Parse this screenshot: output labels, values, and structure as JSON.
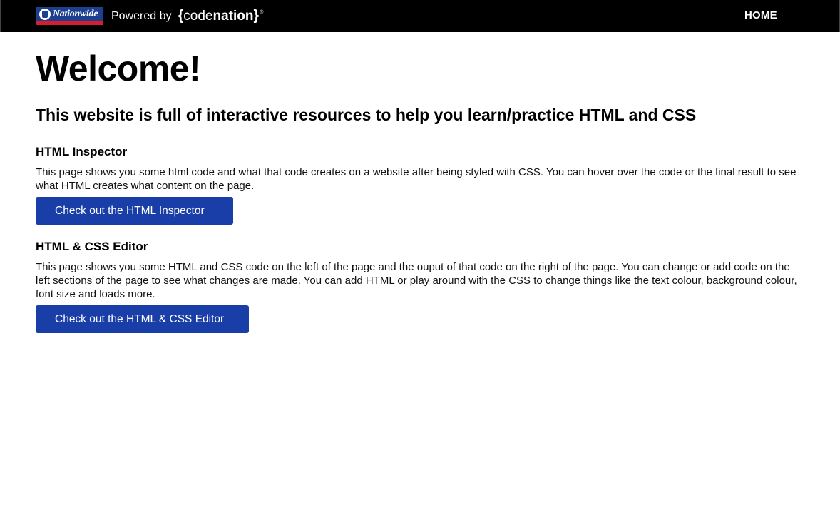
{
  "header": {
    "nationwide_logo_text": "Nationwide",
    "powered_by": "Powered by",
    "codenation": {
      "open_brace": "{",
      "code": "code",
      "nation": "nation",
      "close_brace": "}",
      "reg": "®"
    },
    "nav": {
      "home": "HOME"
    },
    "colors": {
      "bar": "#000000",
      "nationwide_blue": "#1d3f8f",
      "nationwide_red": "#d81e2c"
    }
  },
  "main": {
    "title": "Welcome!",
    "subtitle": "This website is full of interactive resources to help you learn/practice HTML and CSS",
    "sections": [
      {
        "heading": "HTML Inspector",
        "description": "This page shows you some html code and what that code creates on a website after being styled with CSS. You can hover over the code or the final result to see what HTML creates what content on the page.",
        "button": "Check out the HTML Inspector"
      },
      {
        "heading": "HTML & CSS Editor",
        "description": "This page shows you some HTML and CSS code on the left of the page and the ouput of that code on the right of the page. You can change or add code on the left sections of the page to see what changes are made. You can add HTML or play around with the CSS to change things like the text colour, background colour, font size and loads more.",
        "button": "Check out the HTML & CSS Editor"
      }
    ],
    "colors": {
      "button": "#1a3ea8"
    }
  }
}
